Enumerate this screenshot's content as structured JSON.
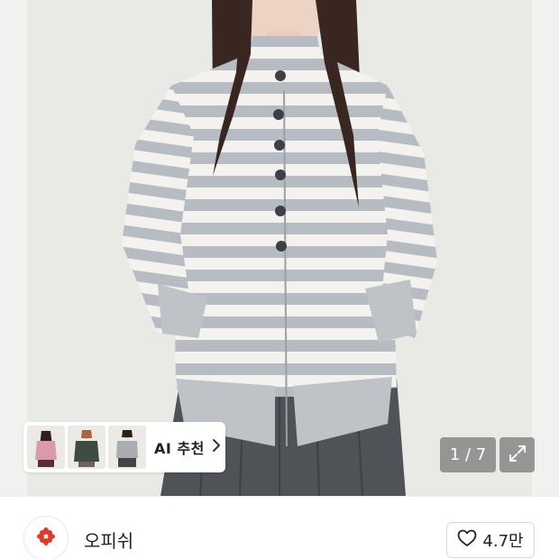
{
  "product_image": {
    "alt_icon": "product-photo",
    "colors": {
      "background": "#e9e9e6",
      "stripe_light": "#f4f2ee",
      "stripe_gray": "#b7bcc3",
      "skirt": "#4f5257",
      "hair": "#3a2620"
    }
  },
  "ai_recommend": {
    "label": "AI 추천",
    "chevron_icon": "chevron-right-icon",
    "thumbnails": [
      "pink-knit-look",
      "green-jacket-look",
      "gray-jacket-look"
    ]
  },
  "gallery": {
    "counter": "1 / 7",
    "expand_icon": "expand-icon"
  },
  "brand": {
    "name": "오피쉬",
    "logo_icon": "flower-logo-icon",
    "logo_color": "#e23a2a"
  },
  "like": {
    "icon": "heart-outline-icon",
    "count": "4.7만"
  }
}
